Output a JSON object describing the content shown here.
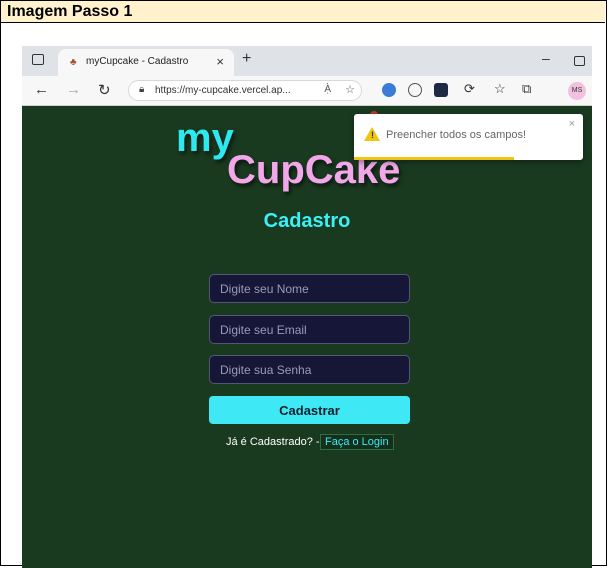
{
  "caption": {
    "text": "Imagem Passo 1"
  },
  "browser": {
    "tab_title": "myCupcake - Cadastro",
    "url": "https://my-cupcake.vercel.ap...",
    "read_aloud": "Ạ̀",
    "avatar": "MS"
  },
  "page": {
    "logo_my": "my",
    "logo_cupcake": "CupCake",
    "heading": "Cadastro",
    "name_placeholder": "Digite seu Nome",
    "email_placeholder": "Digite seu Email",
    "password_placeholder": "Digite sua Senha",
    "submit_label": "Cadastrar",
    "login_prompt": "Já é Cadastrado? -",
    "login_link": "Faça o Login"
  },
  "toast": {
    "message": "Preencher todos os campos!",
    "close": "×",
    "progress": 0.7
  },
  "colors": {
    "accent": "#3ee9f5",
    "background": "#1a3a20",
    "logo_pink": "#f2a7e8",
    "warning": "#f1c40f"
  }
}
